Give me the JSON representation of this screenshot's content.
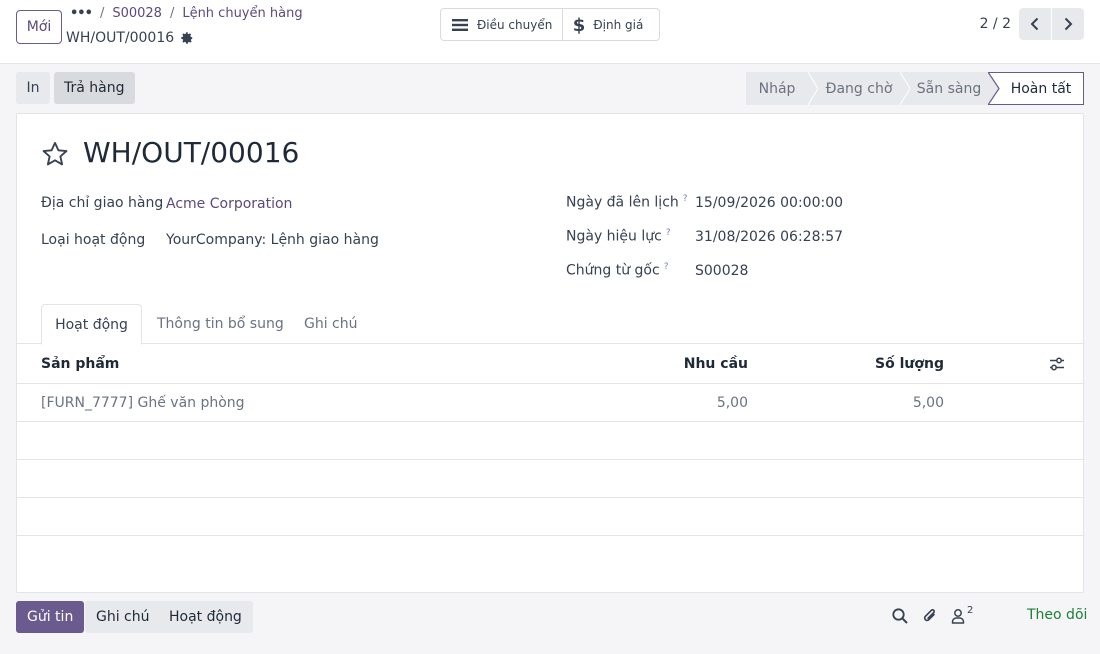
{
  "header": {
    "new_label": "Mới",
    "breadcrumb": [
      "S00028",
      "Lệnh chuyển hàng"
    ],
    "record_name": "WH/OUT/00016",
    "smart_buttons": [
      {
        "icon": "list-icon",
        "label": "Điều chuyển"
      },
      {
        "icon": "dollar-icon",
        "label": "Định giá"
      }
    ],
    "pager": "2 / 2"
  },
  "actions": {
    "print": "In",
    "return": "Trả hàng"
  },
  "stages": [
    "Nháp",
    "Đang chờ",
    "Sẵn sàng",
    "Hoàn tất"
  ],
  "stage_active": "Hoàn tất",
  "form": {
    "title": "WH/OUT/00016",
    "fields_left": [
      {
        "label": "Địa chỉ giao hàng",
        "value": "Acme Corporation"
      },
      {
        "label": "Loại hoạt động",
        "value": "YourCompany: Lệnh giao hàng"
      }
    ],
    "fields_right": [
      {
        "label": "Ngày đã lên lịch",
        "help": "?",
        "value": "15/09/2026 00:00:00"
      },
      {
        "label": "Ngày hiệu lực",
        "help": "?",
        "value": "31/08/2026 06:28:57"
      },
      {
        "label": "Chứng từ gốc",
        "help": "?",
        "value": "S00028"
      }
    ]
  },
  "tabs": [
    "Hoạt động",
    "Thông tin bổ sung",
    "Ghi chú"
  ],
  "table": {
    "columns": [
      "Sản phẩm",
      "Nhu cầu",
      "Số lượng"
    ],
    "rows": [
      {
        "product": "[FURN_7777] Ghế văn phòng",
        "demand": "5,00",
        "quantity": "5,00"
      }
    ]
  },
  "chatter": {
    "send": "Gửi tin",
    "note": "Ghi chú",
    "activity": "Hoạt động",
    "followers_count": "2",
    "follow": "Theo dõi"
  },
  "colors": {
    "primary": "#6b5a8e",
    "follow": "#1a7f37"
  }
}
